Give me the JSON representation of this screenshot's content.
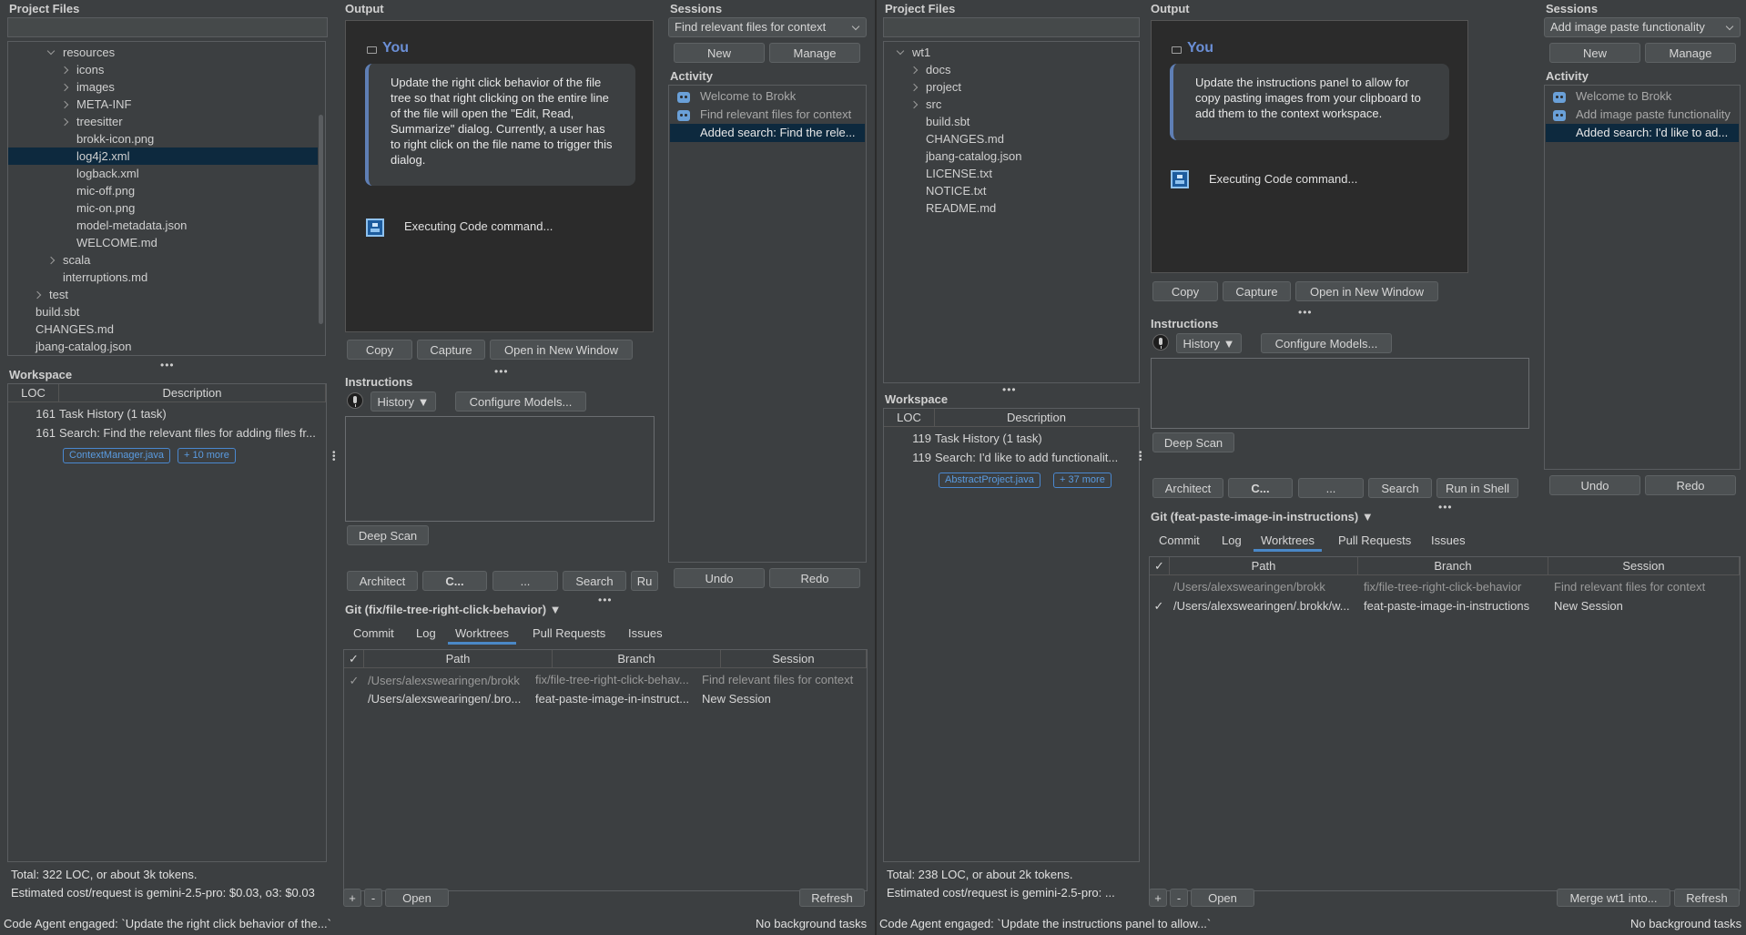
{
  "left": {
    "project_files": {
      "title": "Project Files",
      "tree": [
        {
          "label": "resources",
          "depth": 3,
          "arrow": "down"
        },
        {
          "label": "icons",
          "depth": 4,
          "arrow": "right"
        },
        {
          "label": "images",
          "depth": 4,
          "arrow": "right"
        },
        {
          "label": "META-INF",
          "depth": 4,
          "arrow": "right"
        },
        {
          "label": "treesitter",
          "depth": 4,
          "arrow": "right"
        },
        {
          "label": "brokk-icon.png",
          "depth": 4,
          "arrow": ""
        },
        {
          "label": "log4j2.xml",
          "depth": 4,
          "arrow": "",
          "selected": true
        },
        {
          "label": "logback.xml",
          "depth": 4,
          "arrow": ""
        },
        {
          "label": "mic-off.png",
          "depth": 4,
          "arrow": ""
        },
        {
          "label": "mic-on.png",
          "depth": 4,
          "arrow": ""
        },
        {
          "label": "model-metadata.json",
          "depth": 4,
          "arrow": ""
        },
        {
          "label": "WELCOME.md",
          "depth": 4,
          "arrow": ""
        },
        {
          "label": "scala",
          "depth": 3,
          "arrow": "right"
        },
        {
          "label": "interruptions.md",
          "depth": 3,
          "arrow": ""
        },
        {
          "label": "test",
          "depth": 2,
          "arrow": "right"
        },
        {
          "label": "build.sbt",
          "depth": 1,
          "arrow": ""
        },
        {
          "label": "CHANGES.md",
          "depth": 1,
          "arrow": ""
        },
        {
          "label": "jbang-catalog.json",
          "depth": 1,
          "arrow": ""
        }
      ]
    },
    "workspace": {
      "title": "Workspace",
      "col_loc": "LOC",
      "col_desc": "Description",
      "rows": [
        {
          "loc": "161",
          "desc": "Task History (1 task)"
        },
        {
          "loc": "161",
          "desc": "Search: Find the relevant files for adding files fr..."
        }
      ],
      "chips": [
        "ContextManager.java",
        "+ 10 more"
      ],
      "total": "Total: 322 LOC, or about 3k tokens.",
      "cost": "Estimated cost/request is gemini-2.5-pro: $0.03, o3: $0.03"
    },
    "output": {
      "title": "Output",
      "you": "You",
      "message": "Update the right click behavior of the file tree so that right clicking on the entire line of the file will open the \"Edit, Read, Summarize\" dialog. Currently, a user has to right click on the file name to trigger this dialog.",
      "executing": "Executing Code command...",
      "copy": "Copy",
      "capture": "Capture",
      "open_new": "Open in New Window"
    },
    "sessions": {
      "title": "Sessions",
      "current": "Find relevant files for context",
      "new": "New",
      "manage": "Manage"
    },
    "activity": {
      "title": "Activity",
      "items": [
        "Welcome to Brokk",
        "Find relevant files for context",
        "Added search: Find the rele..."
      ],
      "undo": "Undo",
      "redo": "Redo"
    },
    "instructions": {
      "title": "Instructions",
      "history": "History ▼",
      "configure": "Configure Models...",
      "deep_scan": "Deep Scan",
      "architect": "Architect",
      "code": "C...",
      "ask": "...",
      "search": "Search",
      "run": "Ru"
    },
    "git": {
      "title": "Git (fix/file-tree-right-click-behavior) ▼",
      "tabs": [
        "Commit",
        "Log",
        "Worktrees",
        "Pull Requests",
        "Issues"
      ],
      "active_tab": "Worktrees",
      "check_header": "✓",
      "col_path": "Path",
      "col_branch": "Branch",
      "col_session": "Session",
      "rows": [
        {
          "check": "✓",
          "path": "/Users/alexswearingen/brokk",
          "branch": "fix/file-tree-right-click-behav...",
          "session": "Find relevant files for context",
          "dim": true
        },
        {
          "check": "",
          "path": "/Users/alexswearingen/.bro...",
          "branch": "feat-paste-image-in-instruct...",
          "session": "New Session",
          "dim": false
        }
      ],
      "plus": "+",
      "minus": "-",
      "open": "Open",
      "refresh": "Refresh"
    },
    "status_left": "Code Agent engaged: `Update the right click behavior of the...`",
    "status_right": "No background tasks"
  },
  "right": {
    "project_files": {
      "title": "Project Files",
      "tree": [
        {
          "label": "wt1",
          "depth": 1,
          "arrow": "down"
        },
        {
          "label": "docs",
          "depth": 2,
          "arrow": "right"
        },
        {
          "label": "project",
          "depth": 2,
          "arrow": "right"
        },
        {
          "label": "src",
          "depth": 2,
          "arrow": "right"
        },
        {
          "label": "build.sbt",
          "depth": 2,
          "arrow": ""
        },
        {
          "label": "CHANGES.md",
          "depth": 2,
          "arrow": ""
        },
        {
          "label": "jbang-catalog.json",
          "depth": 2,
          "arrow": ""
        },
        {
          "label": "LICENSE.txt",
          "depth": 2,
          "arrow": ""
        },
        {
          "label": "NOTICE.txt",
          "depth": 2,
          "arrow": ""
        },
        {
          "label": "README.md",
          "depth": 2,
          "arrow": ""
        }
      ]
    },
    "workspace": {
      "title": "Workspace",
      "col_loc": "LOC",
      "col_desc": "Description",
      "rows": [
        {
          "loc": "119",
          "desc": "Task History (1 task)"
        },
        {
          "loc": "119",
          "desc": "Search: I'd like to add functionalit..."
        }
      ],
      "chips": [
        "AbstractProject.java",
        "+ 37 more"
      ],
      "total": "Total: 238 LOC, or about 2k tokens.",
      "cost": "Estimated cost/request is gemini-2.5-pro: ..."
    },
    "output": {
      "title": "Output",
      "you": "You",
      "message": "Update the instructions panel to allow for copy pasting images from your clipboard to add them to the context workspace.",
      "executing": "Executing Code command...",
      "copy": "Copy",
      "capture": "Capture",
      "open_new": "Open in New Window"
    },
    "sessions": {
      "title": "Sessions",
      "current": "Add image paste functionality",
      "new": "New",
      "manage": "Manage"
    },
    "activity": {
      "title": "Activity",
      "items": [
        "Welcome to Brokk",
        "Add image paste functionality",
        "Added search: I'd like to ad..."
      ],
      "undo": "Undo",
      "redo": "Redo"
    },
    "instructions": {
      "title": "Instructions",
      "history": "History ▼",
      "configure": "Configure Models...",
      "deep_scan": "Deep Scan",
      "architect": "Architect",
      "code": "C...",
      "ask": "...",
      "search": "Search",
      "run": "Run in Shell"
    },
    "git": {
      "title": "Git (feat-paste-image-in-instructions) ▼",
      "tabs": [
        "Commit",
        "Log",
        "Worktrees",
        "Pull Requests",
        "Issues"
      ],
      "active_tab": "Worktrees",
      "check_header": "✓",
      "col_path": "Path",
      "col_branch": "Branch",
      "col_session": "Session",
      "rows": [
        {
          "check": "",
          "path": "/Users/alexswearingen/brokk",
          "branch": "fix/file-tree-right-click-behavior",
          "session": "Find relevant files for context",
          "dim": true
        },
        {
          "check": "✓",
          "path": "/Users/alexswearingen/.brokk/w...",
          "branch": "feat-paste-image-in-instructions",
          "session": "New Session",
          "dim": false
        }
      ],
      "plus": "+",
      "minus": "-",
      "open": "Open",
      "merge": "Merge wt1 into...",
      "refresh": "Refresh"
    },
    "status_left": "Code Agent engaged: `Update the instructions panel to allow...`",
    "status_right": "No background tasks"
  }
}
